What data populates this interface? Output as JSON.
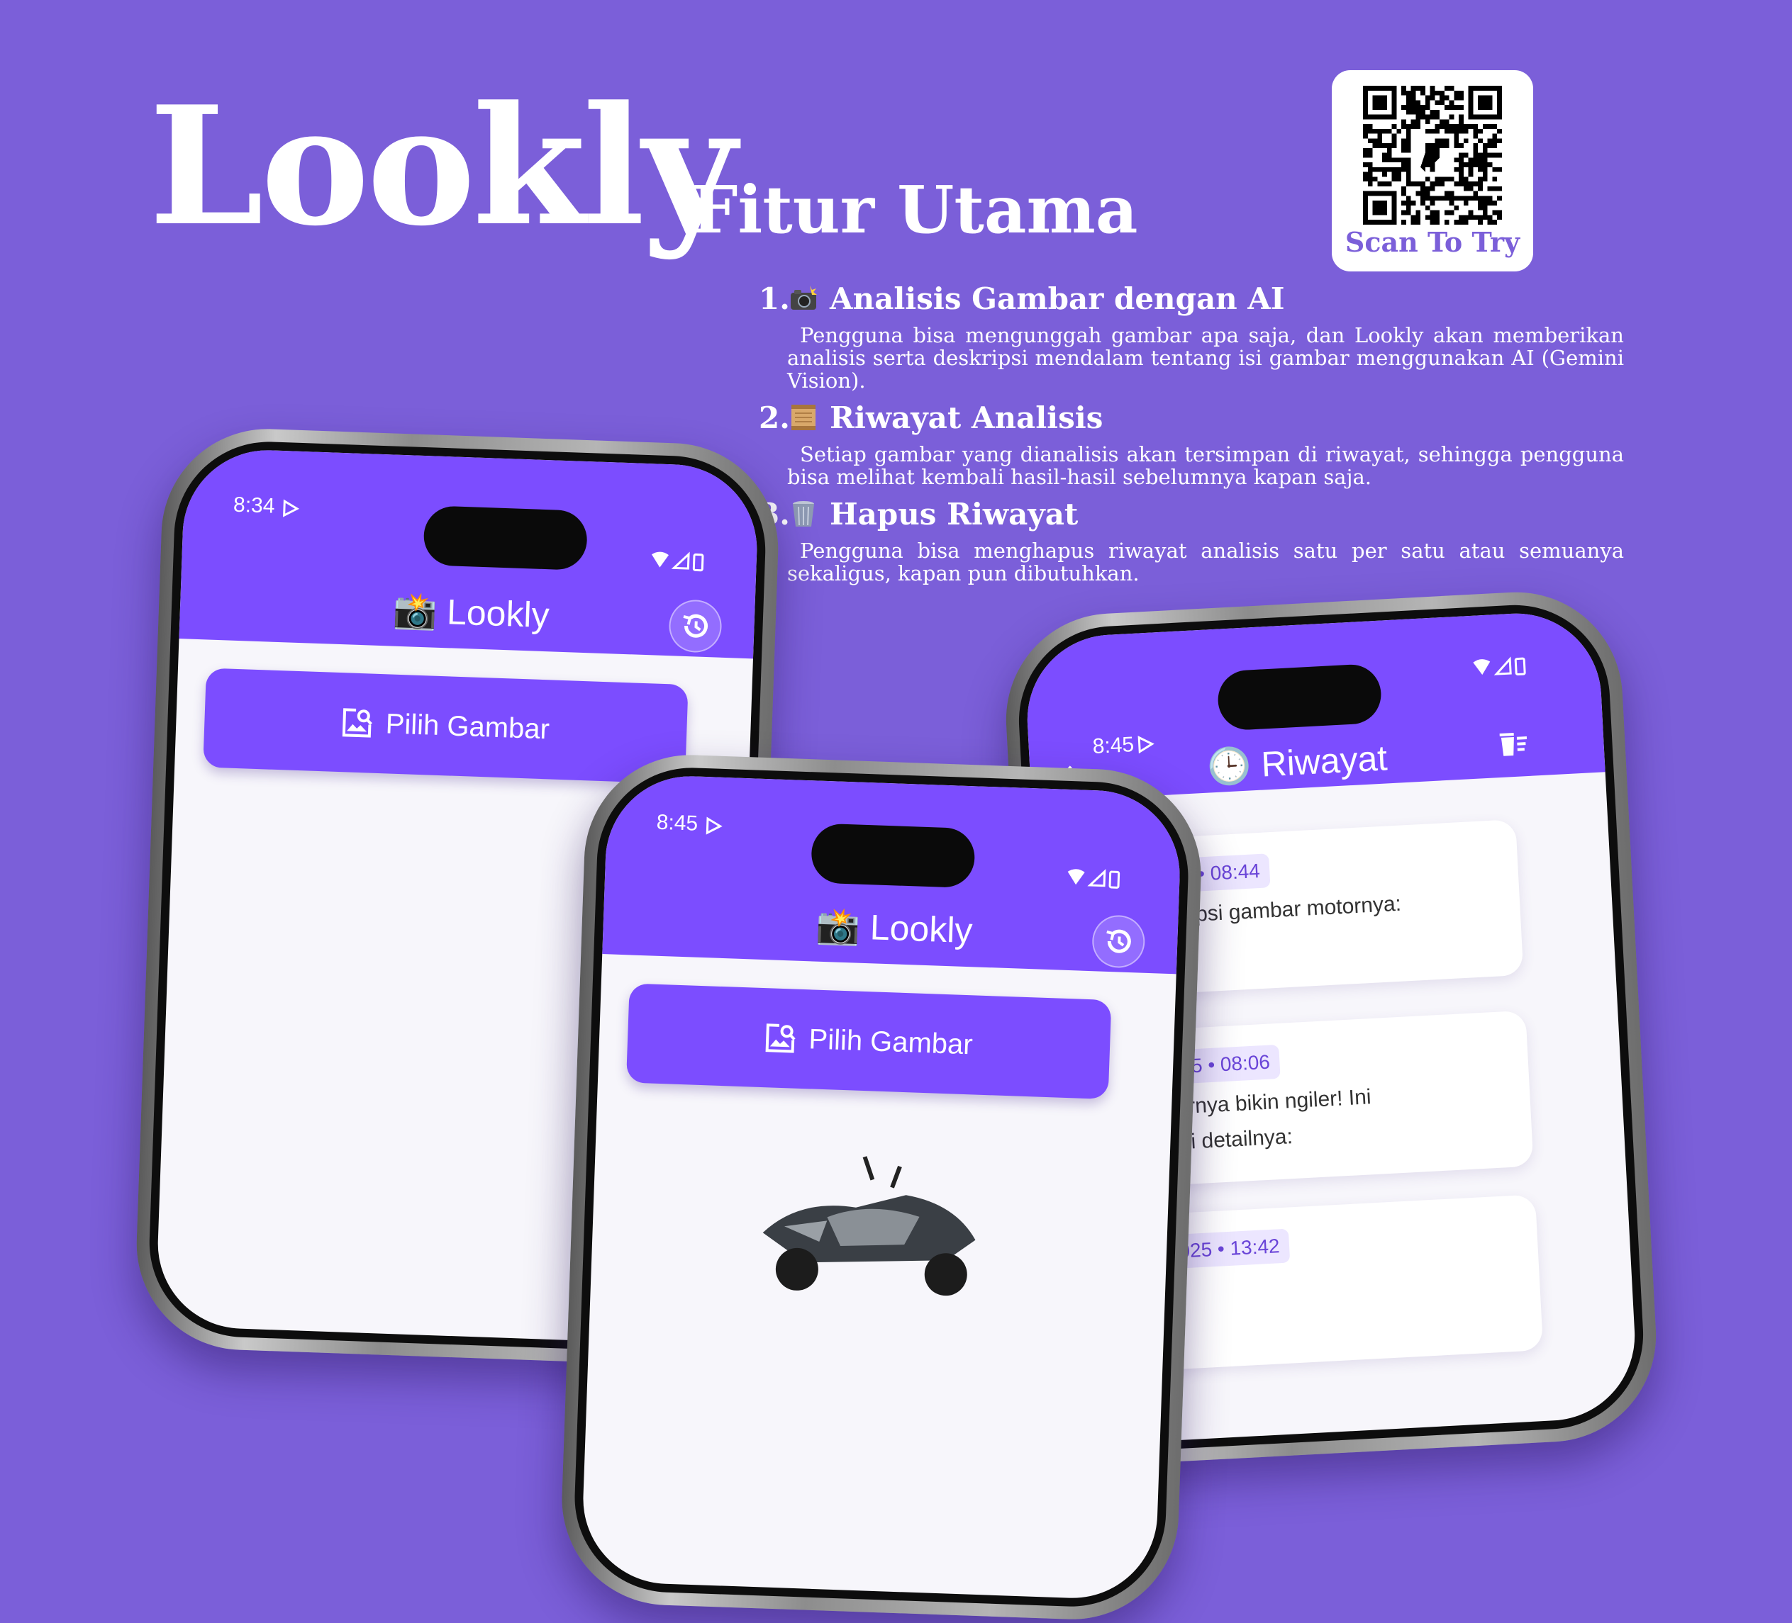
{
  "brand": "Lookly",
  "subtitle": "Fitur Utama",
  "qr": {
    "caption": "Scan To Try",
    "icon": "qr-code-icon"
  },
  "features": [
    {
      "number": "1.",
      "icon": "camera-flash-icon",
      "title": "Analisis Gambar dengan AI",
      "description": "Pengguna bisa mengunggah gambar apa saja, dan Lookly akan memberikan analisis serta deskripsi mendalam tentang isi gambar menggunakan AI (Gemini Vision)."
    },
    {
      "number": "2.",
      "icon": "scroll-icon",
      "title": "Riwayat Analisis",
      "description": "Setiap gambar yang dianalisis akan tersimpan di riwayat, sehingga pengguna bisa melihat kembali hasil-hasil sebelumnya kapan saja."
    },
    {
      "number": "3.",
      "icon": "wastebasket-icon",
      "title": "Hapus Riwayat",
      "description": "Pengguna bisa menghapus riwayat analisis satu per satu atau semuanya sekaligus, kapan pun dibutuhkan."
    }
  ],
  "phone_left": {
    "time": "8:34",
    "app_title": "📸 Lookly",
    "history_icon": "history-icon",
    "button_label": "Pilih Gambar"
  },
  "phone_center": {
    "time": "8:45",
    "app_title": "📸 Lookly",
    "history_icon": "history-icon",
    "button_label": "Pilih Gambar",
    "preview": "motorcycle-image"
  },
  "phone_right": {
    "time": "8:45",
    "app_title": "🕒 Riwayat",
    "back_icon": "back-arrow-icon",
    "delete_icon": "delete-all-icon",
    "items": [
      {
        "date": "16 Apr 2025 • 08:44",
        "text": "ke, ini deskripsi gambar motornya:"
      },
      {
        "date": "16 Apr 2025 • 08:06",
        "text": "ah, gambarnya bikin ngiler!  Ini dia eskripsi detailnya:"
      },
      {
        "date": "15 Apr 2025 • 13:42",
        "text": ""
      }
    ]
  },
  "colors": {
    "background": "#7b5fd9",
    "app_bar": "#7c4dff",
    "chip": "#ece6ff"
  }
}
